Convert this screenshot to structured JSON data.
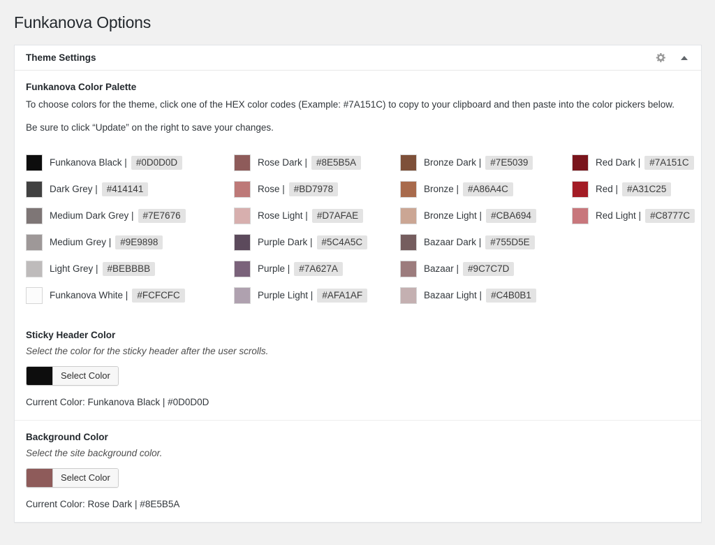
{
  "page": {
    "title": "Funkanova Options"
  },
  "panel": {
    "title": "Theme Settings",
    "gear_icon": "gear-icon",
    "toggle_icon": "caret-up-icon"
  },
  "palette_section": {
    "heading": "Funkanova Color Palette",
    "paragraph_1": "To choose colors for the theme, click one of the HEX color codes (Example: #7A151C) to copy to your clipboard and then paste into the color pickers below.",
    "paragraph_2": "Be sure to click “Update” on the right to save your changes.",
    "separator": "|",
    "columns": [
      [
        {
          "name": "Funkanova Black",
          "hex": "#0D0D0D"
        },
        {
          "name": "Dark Grey",
          "hex": "#414141"
        },
        {
          "name": "Medium Dark Grey",
          "hex": "#7E7676"
        },
        {
          "name": "Medium Grey",
          "hex": "#9E9898"
        },
        {
          "name": "Light Grey",
          "hex": "#BEBBBB"
        },
        {
          "name": "Funkanova White",
          "hex": "#FCFCFC"
        }
      ],
      [
        {
          "name": "Rose Dark",
          "hex": "#8E5B5A"
        },
        {
          "name": "Rose",
          "hex": "#BD7978"
        },
        {
          "name": "Rose Light",
          "hex": "#D7AFAE"
        },
        {
          "name": "Purple Dark",
          "hex": "#5C4A5C"
        },
        {
          "name": "Purple",
          "hex": "#7A627A"
        },
        {
          "name": "Purple Light",
          "hex": "#AFA1AF"
        }
      ],
      [
        {
          "name": "Bronze Dark",
          "hex": "#7E5039"
        },
        {
          "name": "Bronze",
          "hex": "#A86A4C"
        },
        {
          "name": "Bronze Light",
          "hex": "#CBA694"
        },
        {
          "name": "Bazaar Dark",
          "hex": "#755D5E"
        },
        {
          "name": "Bazaar",
          "hex": "#9C7C7D"
        },
        {
          "name": "Bazaar Light",
          "hex": "#C4B0B1"
        }
      ],
      [
        {
          "name": "Red Dark",
          "hex": "#7A151C"
        },
        {
          "name": "Red",
          "hex": "#A31C25"
        },
        {
          "name": "Red Light",
          "hex": "#C8777C"
        }
      ]
    ]
  },
  "settings": [
    {
      "key": "sticky-header-color",
      "heading": "Sticky Header Color",
      "description": "Select the color for the sticky header after the user scrolls.",
      "button_label": "Select Color",
      "swatch_hex": "#0D0D0D",
      "current_color": "Current Color: Funkanova Black | #0D0D0D"
    },
    {
      "key": "background-color",
      "heading": "Background Color",
      "description": "Select the site background color.",
      "button_label": "Select Color",
      "swatch_hex": "#8E5B5A",
      "current_color": "Current Color: Rose Dark | #8E5B5A"
    }
  ]
}
